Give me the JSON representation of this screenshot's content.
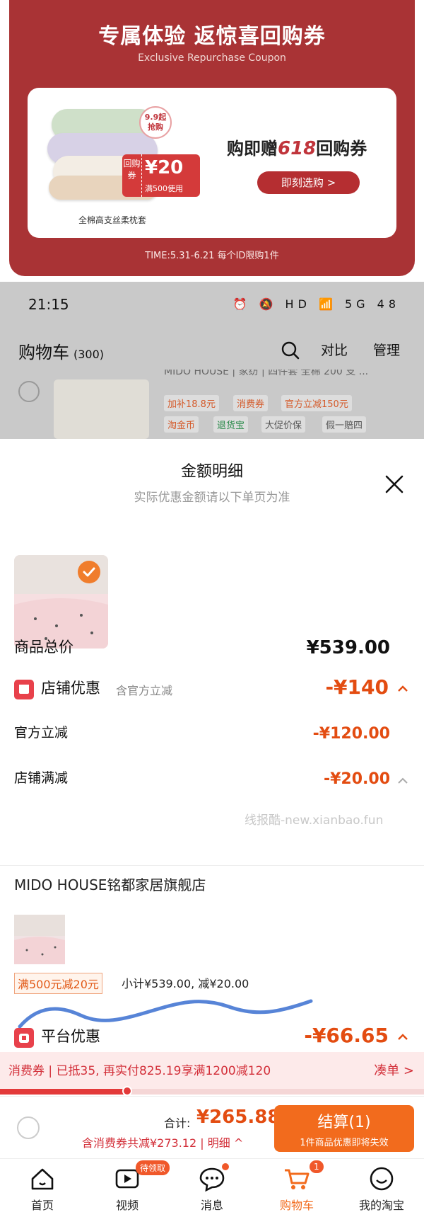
{
  "banner": {
    "title": "专属体验 返惊喜回购券",
    "subtitle": "Exclusive Repurchase Coupon",
    "price_badge_top": "9.9起",
    "price_badge_bottom": "抢购",
    "coupon_left": "回购券",
    "coupon_amount": "¥20",
    "coupon_condition": "满500使用",
    "pillow_caption": "全棉高支丝柔枕套",
    "offer_prefix": "购即赠",
    "offer_highlight": "618",
    "offer_suffix": "回购券",
    "cta_label": "即刻选购 >",
    "time_text": "TIME:5.31-6.21 每个ID限购1件"
  },
  "status_bar": {
    "time": "21:15",
    "icons_text": "⏰ 🔕 HD 📶 5G 48"
  },
  "cart_header": {
    "title": "购物车",
    "count": "(300)",
    "compare": "对比",
    "manage": "管理",
    "row_title": "MIDO HOUSE | 家纺 | 四件套 全棉 200 支 ...",
    "tags": [
      "加补18.8元",
      "消费券",
      "官方立减150元",
      "淘金币",
      "退货宝",
      "大促价保",
      "假一赔四"
    ]
  },
  "sheet": {
    "title": "金额明细",
    "subtitle": "实际优惠金额请以下单页为准",
    "goods_total_label": "商品总价",
    "goods_total_value": "¥539.00",
    "store_discount_label": "店铺优惠",
    "store_discount_note": "含官方立减",
    "store_discount_value": "-¥140",
    "official_cut_label": "官方立减",
    "official_cut_value": "-¥120.00",
    "store_full_cut_label": "店铺满减",
    "store_full_cut_value": "-¥20.00",
    "watermark": "线报酷-new.xianbao.fun",
    "shop_name": "MIDO HOUSE铭都家居旗舰店",
    "promo_tag": "满500元减20元",
    "subtotal": "小计¥539.00, 减¥20.00",
    "platform_discount_label": "平台优惠",
    "platform_discount_value": "-¥66.65"
  },
  "strip": {
    "text": "消费券 | 已抵35, 再实付825.19享满1200减120",
    "link": "凑单 >",
    "progress": 0.3
  },
  "checkout": {
    "total_label": "合计:",
    "total_value": "¥265.88",
    "discount_line": "含消费券共减¥273.12 | 明细 ^",
    "button_label": "结算(1)",
    "button_sub": "1件商品优惠即将失效"
  },
  "tabs": [
    {
      "label": "首页",
      "icon": "home-icon"
    },
    {
      "label": "视频",
      "icon": "video-icon",
      "badge": "待领取"
    },
    {
      "label": "消息",
      "icon": "message-icon"
    },
    {
      "label": "购物车",
      "icon": "cart-icon",
      "badge": "1"
    },
    {
      "label": "我的淘宝",
      "icon": "profile-icon"
    }
  ],
  "colors": {
    "banner_red": "#a93335",
    "discount_orange": "#e34c11",
    "checkout_orange": "#f26b1d",
    "tab_active": "#f26b1d"
  }
}
